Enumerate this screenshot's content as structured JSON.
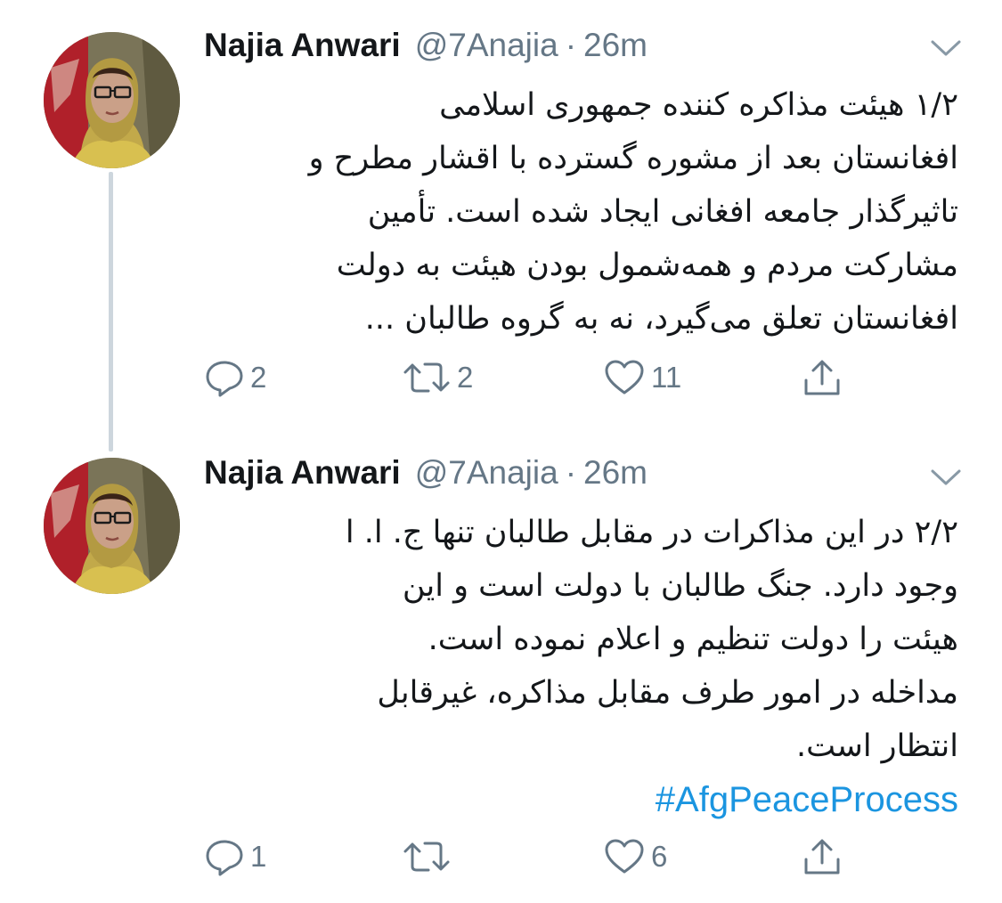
{
  "tweets": [
    {
      "author_name": "Najia Anwari",
      "handle": "@7Anajia",
      "separator": "·",
      "time": "26m",
      "text_lines": [
        "۱/۲ هیئت مذاکره کننده جمهوری اسلامی",
        "افغانستان بعد از مشوره گسترده با اقشار مطرح و",
        "تاثیرگذار جامعه افغانی ایجاد شده است. تأمین",
        "مشارکت مردم و همه‌شمول بودن هیئت به دولت",
        "افغانستان تعلق می‌گیرد، نه به گروه طالبان ..."
      ],
      "hashtag": "",
      "reply_count": "2",
      "retweet_count": "2",
      "like_count": "11"
    },
    {
      "author_name": "Najia Anwari",
      "handle": "@7Anajia",
      "separator": "·",
      "time": "26m",
      "text_lines": [
        "۲/۲ در این مذاکرات در مقابل طالبان تنها ج. ا. ا",
        "وجود دارد. جنگ طالبان با دولت است و این",
        "هیئت را دولت تنظیم و اعلام نموده است.",
        "مداخله در امور طرف مقابل مذاکره، غیرقابل",
        "انتظار است."
      ],
      "hashtag": "#AfgPeaceProcess",
      "reply_count": "1",
      "retweet_count": "",
      "like_count": "6"
    }
  ],
  "icons": {
    "reply": "reply-icon",
    "retweet": "retweet-icon",
    "like": "heart-icon",
    "share": "share-icon",
    "menu": "chevron-down-icon"
  },
  "colors": {
    "text": "#14171a",
    "secondary": "#657786",
    "link": "#1b95e0",
    "thread_line": "#cdd6dd"
  }
}
